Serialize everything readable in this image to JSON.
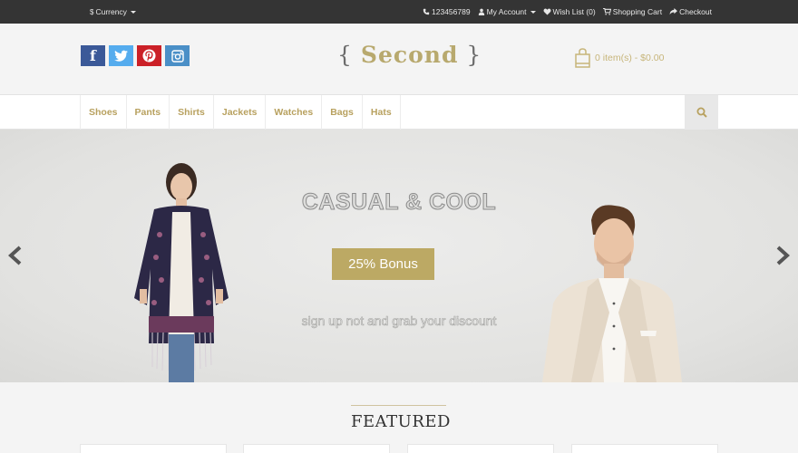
{
  "topbar": {
    "currency": "Currency",
    "phone": "123456789",
    "my_account": "My Account",
    "wish_list": "Wish List (0)",
    "shopping_cart": "Shopping Cart",
    "checkout": "Checkout"
  },
  "header": {
    "logo_open": "{",
    "logo_word": "Second",
    "logo_close": "}",
    "cart_summary": "0 item(s) - $0.00"
  },
  "nav": {
    "items": [
      "Shoes",
      "Pants",
      "Shirts",
      "Jackets",
      "Watches",
      "Bags",
      "Hats"
    ]
  },
  "hero": {
    "headline": "CASUAL & COOL",
    "bonus_button": "25% Bonus",
    "tagline": "sign up not and grab your discount"
  },
  "featured": {
    "title": "FEATURED"
  },
  "colors": {
    "accent": "#bca964",
    "topbar": "#343434",
    "facebook": "#3b5998",
    "twitter": "#55acee",
    "pinterest": "#cb2027",
    "instagram": "#4a8fc7"
  }
}
